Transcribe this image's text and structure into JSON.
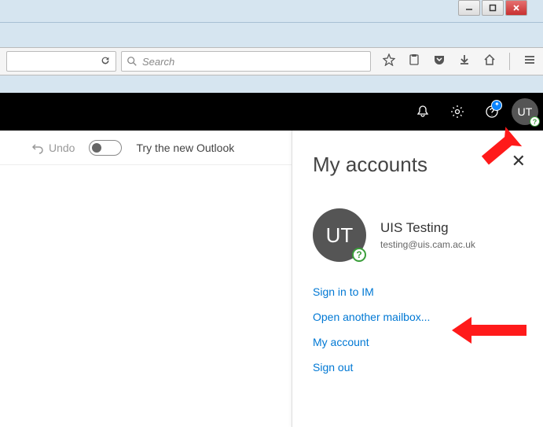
{
  "window": {
    "minimize": "–",
    "maximize": "□",
    "close": "×"
  },
  "browser": {
    "search_placeholder": "Search"
  },
  "subtoolbar": {
    "undo_label": "Undo",
    "toggle_label": "Try the new Outlook"
  },
  "header": {
    "avatar_initials": "UT",
    "presence_glyph": "?"
  },
  "panel": {
    "title": "My accounts",
    "close": "✕",
    "avatar_initials": "UT",
    "presence_glyph": "?",
    "account_name": "UIS Testing",
    "account_email": "testing@uis.cam.ac.uk",
    "links": {
      "sign_in_im": "Sign in to IM",
      "open_mailbox": "Open another mailbox...",
      "my_account": "My account",
      "sign_out": "Sign out"
    }
  }
}
